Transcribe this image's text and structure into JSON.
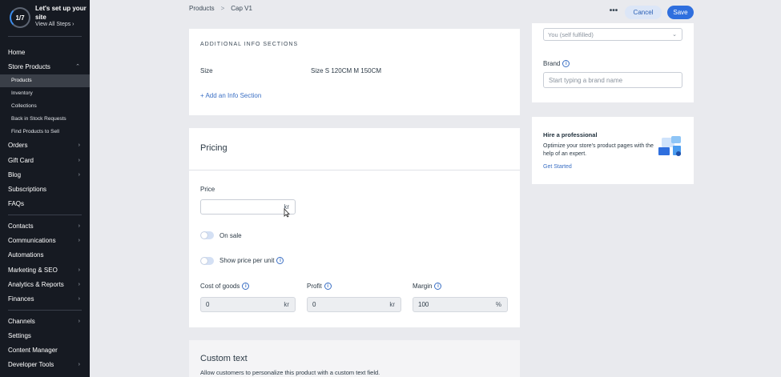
{
  "setup": {
    "progress": "1/7",
    "title": "Let's set up your site",
    "link": "View All Steps"
  },
  "sidebar": {
    "items": [
      {
        "label": "Home",
        "chevron": false
      },
      {
        "label": "Store Products",
        "chevron": true,
        "expanded": true
      }
    ],
    "sub_items": [
      "Products",
      "Inventory",
      "Collections",
      "Back in Stock Requests",
      "Find Products to Sell"
    ],
    "items2": [
      "Orders",
      "Gift Card",
      "Blog",
      "Subscriptions",
      "FAQs"
    ],
    "items3": [
      "Contacts",
      "Communications",
      "Automations",
      "Marketing & SEO",
      "Analytics & Reports",
      "Finances"
    ],
    "items4": [
      "Channels",
      "Settings",
      "Content Manager",
      "Developer Tools"
    ]
  },
  "breadcrumb": {
    "root": "Products",
    "separator": ">",
    "current": "Cap V1"
  },
  "toolbar": {
    "more_label": "•••",
    "cancel_label": "Cancel",
    "save_label": "Save"
  },
  "additional_info": {
    "section_label": "ADDITIONAL INFO SECTIONS",
    "row_label": "Size",
    "row_value": "Size S 120CM M 150CM",
    "add_link": "+ Add an Info Section"
  },
  "pricing": {
    "title": "Pricing",
    "price_label": "Price",
    "price_unit": "kr",
    "on_sale_label": "On sale",
    "price_per_unit_label": "Show price per unit",
    "cost_label": "Cost of goods",
    "cost_value": "0",
    "cost_unit": "kr",
    "profit_label": "Profit",
    "profit_value": "0",
    "profit_unit": "kr",
    "margin_label": "Margin",
    "margin_value": "100",
    "margin_unit": "%",
    "info_glyph": "i"
  },
  "custom_text": {
    "title": "Custom text",
    "description": "Allow customers to personalize this product with a custom text field."
  },
  "right": {
    "fulfillment_value": "You (self fulfilled)",
    "brand_label": "Brand",
    "brand_placeholder": "Start typing a brand name",
    "hire_title": "Hire a professional",
    "hire_text": "Optimize your store's product pages with the help of an expert.",
    "hire_link": "Get Started"
  },
  "colors": {
    "accent": "#2f6fde",
    "sidebar_bg": "#161a22",
    "link": "#3a6fc4"
  }
}
